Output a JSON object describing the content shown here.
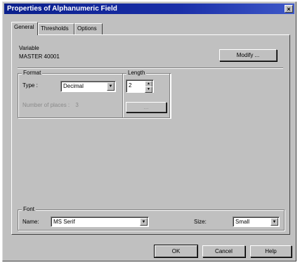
{
  "window": {
    "title": "Properties of Alphanumeric Field",
    "close_glyph": "×"
  },
  "tabs": [
    {
      "label": "General",
      "active": true
    },
    {
      "label": "Thresholds",
      "active": false
    },
    {
      "label": "Options",
      "active": false
    }
  ],
  "variable": {
    "label": "Variable",
    "value": "MASTER 40001",
    "modify_label": "Modify ..."
  },
  "format": {
    "group_label": "Format",
    "type_label": "Type :",
    "type_value": "Decimal",
    "decimal_places_label": "Number of places :",
    "decimal_places_value": "3"
  },
  "length": {
    "group_label": "Length",
    "value": "2",
    "button_label": "..."
  },
  "font": {
    "group_label": "Font",
    "name_label": "Name:",
    "name_value": "MS Serif",
    "size_label": "Size:",
    "size_value": "Small"
  },
  "footer": {
    "ok_label": "OK",
    "cancel_label": "Cancel",
    "help_label": "Help"
  },
  "icons": {
    "dropdown": "▼",
    "spin_up": "▲",
    "spin_down": "▼"
  }
}
